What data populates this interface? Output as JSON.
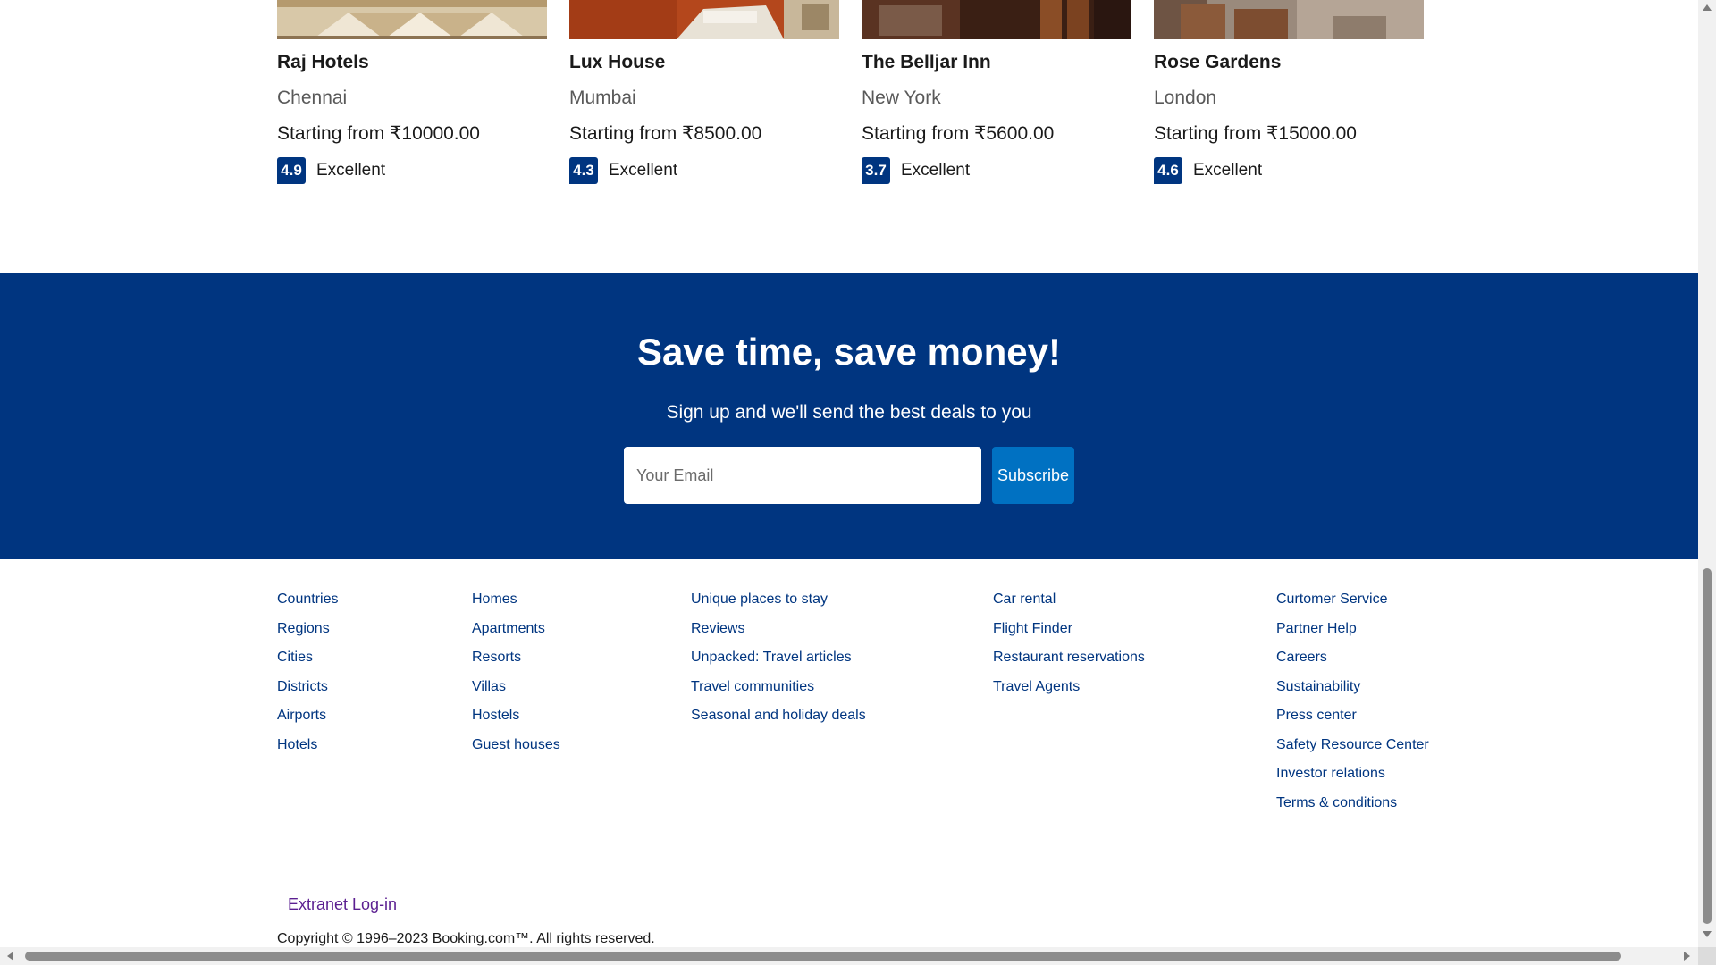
{
  "hotels": [
    {
      "name": "Raj Hotels",
      "city": "Chennai",
      "price": "Starting from ₹10000.00",
      "score": "4.9",
      "score_word": "Excellent"
    },
    {
      "name": "Lux House",
      "city": "Mumbai",
      "price": "Starting from ₹8500.00",
      "score": "4.3",
      "score_word": "Excellent"
    },
    {
      "name": "The Belljar Inn",
      "city": "New York",
      "price": "Starting from ₹5600.00",
      "score": "3.7",
      "score_word": "Excellent"
    },
    {
      "name": "Rose Gardens",
      "city": "London",
      "price": "Starting from ₹15000.00",
      "score": "4.6",
      "score_word": "Excellent"
    }
  ],
  "newsletter": {
    "title": "Save time, save money!",
    "subtitle": "Sign up and we'll send the best deals to you",
    "email_placeholder": "Your Email",
    "button_label": "Subscribe"
  },
  "footer": {
    "columns": [
      [
        "Countries",
        "Regions",
        "Cities",
        "Districts",
        "Airports",
        "Hotels"
      ],
      [
        "Homes",
        "Apartments",
        "Resorts",
        "Villas",
        "Hostels",
        "Guest houses"
      ],
      [
        "Unique places to stay",
        "Reviews",
        "Unpacked: Travel articles",
        "Travel communities",
        "Seasonal and holiday deals"
      ],
      [
        "Car rental",
        "Flight Finder",
        "Restaurant reservations",
        "Travel Agents"
      ],
      [
        "Curtomer Service",
        "Partner Help",
        "Careers",
        "Sustainability",
        "Press center",
        "Safety Resource Center",
        "Investor relations",
        "Terms & conditions"
      ]
    ],
    "extranet_label": "Extranet Log-in",
    "copyright": "Copyright © 1996–2023 Booking.com™. All rights reserved."
  },
  "colors": {
    "brand_navy": "#003580",
    "button_blue": "#0071c2",
    "link_color": "#003580"
  }
}
